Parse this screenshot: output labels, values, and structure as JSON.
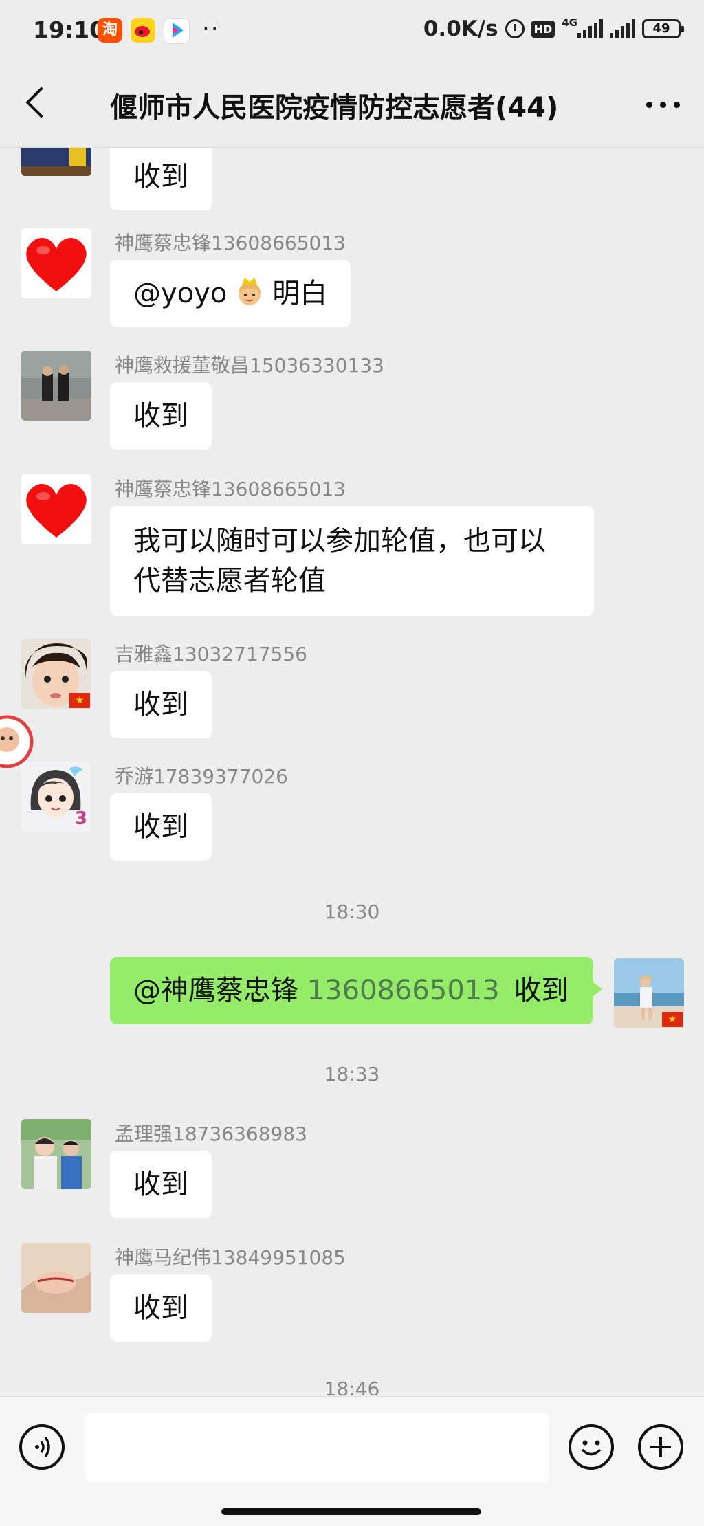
{
  "status_bar": {
    "time": "19:10",
    "apps": [
      "taobao-icon",
      "weibo-icon",
      "youku-icon"
    ],
    "dots": "··",
    "speed": "0.0K/s",
    "hd": "HD",
    "network": "4G",
    "battery": "49"
  },
  "header": {
    "title": "偃师市人民医院疫情防控志愿者(44)"
  },
  "messages": [
    {
      "side": "left",
      "sender": "",
      "text": "收到",
      "avatar": "partial-avatar"
    },
    {
      "side": "left",
      "sender": "神鹰蔡忠锋13608665013",
      "text_before": "@yoyo",
      "text_after": "明白",
      "avatar": "heart-avatar",
      "emoji": "princess-emoji"
    },
    {
      "side": "left",
      "sender": "神鹰救援董敬昌15036330133",
      "text": "收到",
      "avatar": "two-men-photo-avatar"
    },
    {
      "side": "left",
      "sender": "神鹰蔡忠锋13608665013",
      "text_line1": "我可以随时可以参加轮值，也可以",
      "text_line2": "代替志愿者轮值",
      "avatar": "heart-avatar"
    },
    {
      "side": "left",
      "sender": "吉雅鑫13032717556",
      "text": "收到",
      "avatar": "child-photo-avatar"
    },
    {
      "side": "left",
      "sender": "乔游17839377026",
      "text": "收到",
      "avatar": "cartoon-girl-avatar",
      "badge": "3"
    },
    {
      "side": "right",
      "mention": "@神鹰蔡忠锋",
      "number": "13608665013",
      "text": "收到",
      "avatar": "beach-photo-avatar"
    },
    {
      "side": "left",
      "sender": "孟理强18736368983",
      "text": "收到",
      "avatar": "kids-photo-avatar"
    },
    {
      "side": "left",
      "sender": "神鹰马纪伟13849951085",
      "text": "收到",
      "avatar": "hand-photo-avatar"
    }
  ],
  "timestamps": [
    "18:30",
    "18:33",
    "18:46"
  ],
  "input": {
    "value": "",
    "placeholder": ""
  },
  "colors": {
    "background": "#ededed",
    "self_bubble": "#95ec69",
    "other_bubble": "#ffffff",
    "mention_number": "#4f7c4f"
  }
}
